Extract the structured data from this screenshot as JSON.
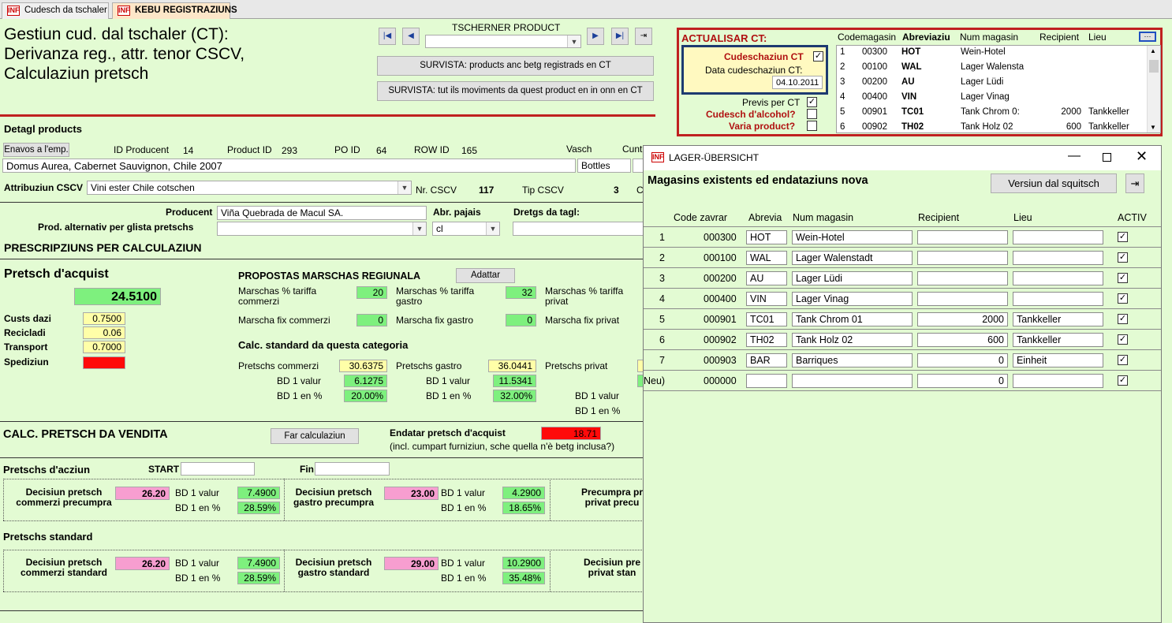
{
  "tabs": [
    {
      "label": "Cudesch da tschaler",
      "icon": "INF"
    },
    {
      "label": "KEBU REGISTRAZIUNS",
      "icon": "INF"
    }
  ],
  "header": {
    "title_lines": [
      "Gestiun cud. dal tschaler (CT):",
      "Derivanza reg., attr. tenor CSCV,",
      "Calculaziun pretsch"
    ],
    "product_picker_label": "TSCHERNER PRODUCT",
    "product_picker_value": "",
    "btn_survista1": "SURVISTA: products anc betg registrads en CT",
    "btn_survista2": "SURVISTA: tut ils moviments da quest product en in onn en CT"
  },
  "ct_panel": {
    "title": "ACTUALISAR CT:",
    "cudeschaziun_label": "Cudeschaziun CT",
    "cudeschaziun_checked": true,
    "data_label": "Data cudeschaziun CT:",
    "data_value": "04.10.2011",
    "previs_label": "Previs per CT",
    "previs_checked": true,
    "alcohol_label": "Cudesch d'alcohol?",
    "alcohol_checked": false,
    "varia_label": "Varia product?",
    "varia_checked": false,
    "columns": [
      "Codemagasin",
      "Abreviaziu",
      "Num magasin",
      "Recipient",
      "Lieu"
    ],
    "rows": [
      {
        "n": "1",
        "code": "00300",
        "abr": "HOT",
        "name": "Wein-Hotel",
        "rec": "",
        "lieu": ""
      },
      {
        "n": "2",
        "code": "00100",
        "abr": "WAL",
        "name": "Lager Walensta",
        "rec": "",
        "lieu": ""
      },
      {
        "n": "3",
        "code": "00200",
        "abr": "AU",
        "name": "Lager Lüdi",
        "rec": "",
        "lieu": ""
      },
      {
        "n": "4",
        "code": "00400",
        "abr": "VIN",
        "name": "Lager Vinag",
        "rec": "",
        "lieu": ""
      },
      {
        "n": "5",
        "code": "00901",
        "abr": "TC01",
        "name": "Tank Chrom 0:",
        "rec": "2000",
        "lieu": "Tankkeller"
      },
      {
        "n": "6",
        "code": "00902",
        "abr": "TH02",
        "name": "Tank Holz 02",
        "rec": "600",
        "lieu": "Tankkeller"
      }
    ]
  },
  "detail": {
    "section_title": "Detagl products",
    "btn_enavos": "Enavos a l'emp.",
    "id_producent_label": "ID Producent",
    "id_producent": "14",
    "product_id_label": "Product ID",
    "product_id": "293",
    "po_id_label": "PO ID",
    "po_id": "64",
    "row_id_label": "ROW ID",
    "row_id": "165",
    "vasch_label": "Vasch",
    "cunt_label": "Cunt",
    "product_name": "Domus Aurea, Cabernet Sauvignon, Chile 2007",
    "vasch_value": "Bottles",
    "attribuziun_label": "Attribuziun CSCV",
    "attribuziun_value": "Vini ester Chile cotschen",
    "nr_cscv_label": "Nr. CSCV",
    "nr_cscv": "117",
    "tip_cscv_label": "Tip CSCV",
    "tip_cscv": "3",
    "c_label": "C",
    "producent_label": "Producent",
    "producent_value": "Viña Quebrada de Macul SA.",
    "abr_pajais_label": "Abr. pajais",
    "abr_pajais_value": "cl",
    "dretgs_label": "Dretgs da tagl:",
    "prod_alt_label": "Prod. alternativ per glista pretschs"
  },
  "prescripziuns": {
    "title": "PRESCRIPZIUNS PER CALCULAZIUN",
    "pretsch_acquist_label": "Pretsch d'acquist",
    "pretsch_acquist": "24.5100",
    "custs_dazi_label": "Custs dazi",
    "custs_dazi": "0.7500",
    "recicladi_label": "Recicladi",
    "recicladi": "0.06",
    "transport_label": "Transport",
    "transport": "0.7000",
    "spediziun_label": "Spediziun",
    "spediziun": "",
    "propostas_title": "PROPOSTAS MARSCHAS REGIUNALA",
    "btn_adattar": "Adattar",
    "m_tar_comm_label": "Marschas % tariffa commerzi",
    "m_tar_comm": "20",
    "m_tar_gastro_label": "Marschas % tariffa gastro",
    "m_tar_gastro": "32",
    "m_tar_priv_label": "Marschas % tariffa privat",
    "m_fix_comm_label": "Marscha fix commerzi",
    "m_fix_comm": "0",
    "m_fix_gastro_label": "Marscha fix gastro",
    "m_fix_gastro": "0",
    "m_fix_priv_label": "Marscha fix privat",
    "calc_std_title": "Calc. standard da questa categoria",
    "p_comm_label": "Pretschs commerzi",
    "p_comm": "30.6375",
    "p_gastro_label": "Pretschs gastro",
    "p_gastro": "36.0441",
    "p_priv_label": "Pretschs privat",
    "bd1_valur_label": "BD 1 valur",
    "bd1_pct_label": "BD 1 en %",
    "comm_bd_valur": "6.1275",
    "comm_bd_pct": "20.00%",
    "gastro_bd_valur": "11.5341",
    "gastro_bd_pct": "32.00%"
  },
  "vendita": {
    "title": "CALC. PRETSCH DA VENDITA",
    "btn_far": "Far calculaziun",
    "endatar_label": "Endatar pretsch d'acquist",
    "endatar_value": "18.71",
    "endatar_note": "(incl. cumpart furniziun, sche quella n'è betg inclusa?)",
    "acziun_label": "Pretschs d'acziun",
    "start_label": "START",
    "fin_label": "Fin",
    "dec_comm_pre_label": "Decisiun pretsch commerzi precumpra",
    "dec_comm_pre": "26.20",
    "dec_comm_pre_bd": "7.4900",
    "dec_comm_pre_pct": "28.59%",
    "dec_gastro_pre_label": "Decisiun pretsch gastro precumpra",
    "dec_gastro_pre": "23.00",
    "dec_gastro_pre_bd": "4.2900",
    "dec_gastro_pre_pct": "18.65%",
    "dec_priv_pre_label": "Precumpra pr privat precu",
    "standard_label": "Pretschs standard",
    "dec_comm_std_label": "Decisiun pretsch commerzi standard",
    "dec_comm_std": "26.20",
    "dec_comm_std_bd": "7.4900",
    "dec_comm_std_pct": "28.59%",
    "dec_gastro_std_label": "Decisiun pretsch gastro standard",
    "dec_gastro_std": "29.00",
    "dec_gastro_std_bd": "10.2900",
    "dec_gastro_std_pct": "35.48%",
    "dec_priv_std_label": "Decisiun pre privat stan"
  },
  "dialog": {
    "title": "LAGER-ÜBERSICHT",
    "heading": "Magasins existents ed endataziuns nova",
    "btn_version": "Versiun dal squitsch",
    "columns": [
      "Code zavrar",
      "Abrevia",
      "Num magasin",
      "Recipient",
      "Lieu",
      "ACTIV"
    ],
    "rows": [
      {
        "n": "1",
        "code": "000300",
        "abr": "HOT",
        "name": "Wein-Hotel",
        "rec": "",
        "lieu": "",
        "activ": true
      },
      {
        "n": "2",
        "code": "000100",
        "abr": "WAL",
        "name": "Lager Walenstadt",
        "rec": "",
        "lieu": "",
        "activ": true
      },
      {
        "n": "3",
        "code": "000200",
        "abr": "AU",
        "name": "Lager Lüdi",
        "rec": "",
        "lieu": "",
        "activ": true
      },
      {
        "n": "4",
        "code": "000400",
        "abr": "VIN",
        "name": "Lager Vinag",
        "rec": "",
        "lieu": "",
        "activ": true
      },
      {
        "n": "5",
        "code": "000901",
        "abr": "TC01",
        "name": "Tank Chrom 01",
        "rec": "2000",
        "lieu": "Tankkeller",
        "activ": true
      },
      {
        "n": "6",
        "code": "000902",
        "abr": "TH02",
        "name": "Tank Holz 02",
        "rec": "600",
        "lieu": "Tankkeller",
        "activ": true
      },
      {
        "n": "7",
        "code": "000903",
        "abr": "BAR",
        "name": "Barriques",
        "rec": "0",
        "lieu": "Einheit",
        "activ": true
      },
      {
        "n": "Neu)",
        "code": "000000",
        "abr": "",
        "name": "",
        "rec": "0",
        "lieu": "",
        "activ": true
      }
    ]
  },
  "colors": {
    "accent_red": "#c02020",
    "green_field": "#7ef07e",
    "pink_field": "#f79ed0",
    "yellow_field": "#ffffa8",
    "background": "#e3fbd3"
  }
}
